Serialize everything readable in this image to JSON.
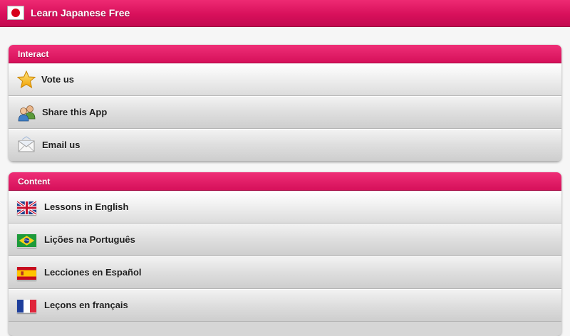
{
  "app": {
    "title": "Learn Japanese Free",
    "flag_icon": "japan-flag-icon",
    "accent_color": "#dd1465"
  },
  "interact": {
    "header": "Interact",
    "items": [
      {
        "label": "Vote us",
        "icon": "star-icon"
      },
      {
        "label": "Share this App",
        "icon": "users-icon"
      },
      {
        "label": "Email us",
        "icon": "envelope-icon"
      }
    ]
  },
  "content": {
    "header": "Content",
    "items": [
      {
        "label": "Lessons in English",
        "icon": "uk-flag-icon"
      },
      {
        "label": "Lições na Português",
        "icon": "brazil-flag-icon"
      },
      {
        "label": "Lecciones en Español",
        "icon": "spain-flag-icon"
      },
      {
        "label": "Leçons en français",
        "icon": "france-flag-icon"
      }
    ]
  }
}
